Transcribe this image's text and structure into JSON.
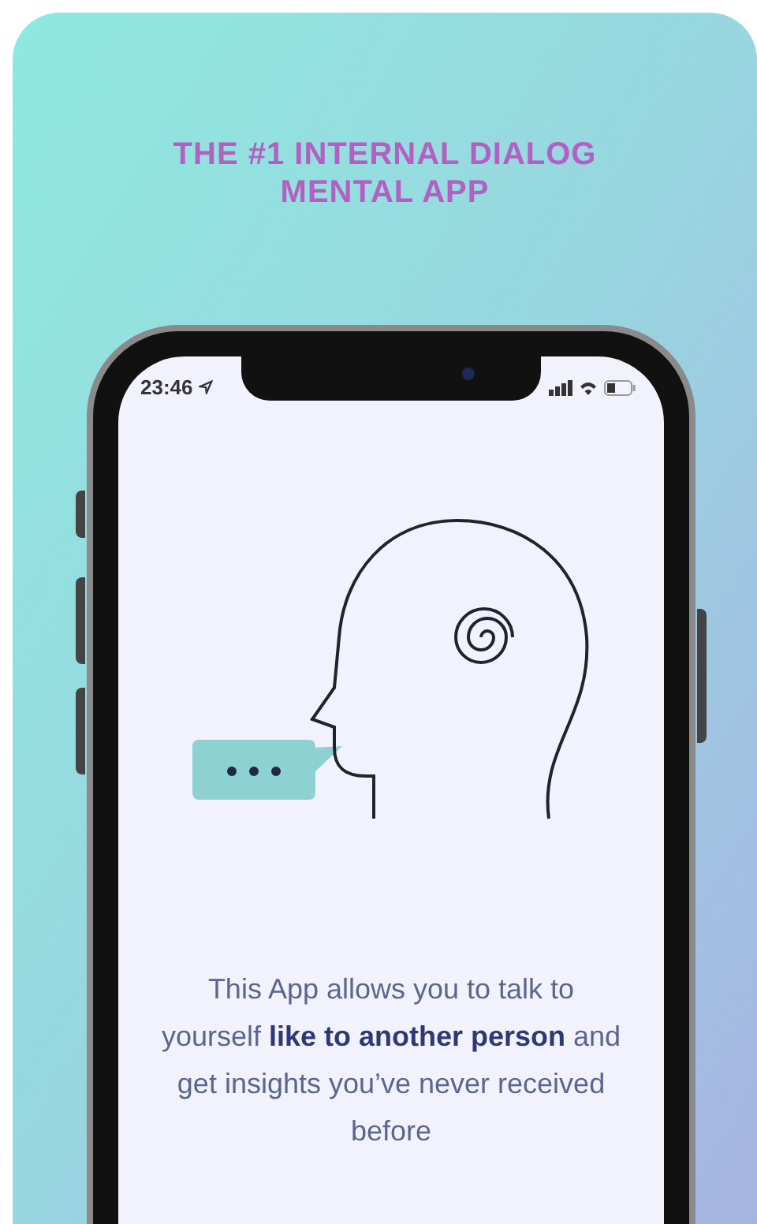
{
  "headline": "THE #1 INTERNAL DIALOG MENTAL APP",
  "status_bar": {
    "time": "23:46"
  },
  "description": "This App allows you to talk to yourself **like to another person** and get insights you’ve never received before"
}
